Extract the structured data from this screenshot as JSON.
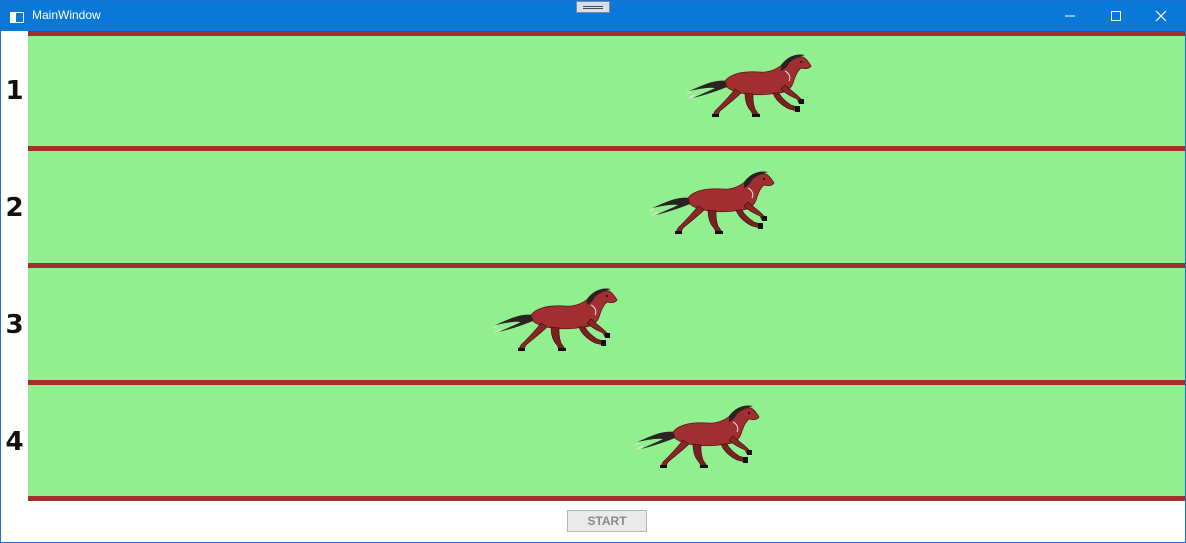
{
  "window": {
    "title": "MainWindow"
  },
  "lanes": [
    {
      "number": "1"
    },
    {
      "number": "2"
    },
    {
      "number": "3"
    },
    {
      "number": "4"
    }
  ],
  "controls": {
    "start_label": "START"
  },
  "colors": {
    "track": "#92ef8f",
    "rail": "#a1302d",
    "horse_body": "#a12e31",
    "titlebar": "#0a78d6"
  },
  "icons": {
    "horse": "horse-icon",
    "minimize": "minimize-icon",
    "maximize": "maximize-icon",
    "close": "close-icon"
  }
}
